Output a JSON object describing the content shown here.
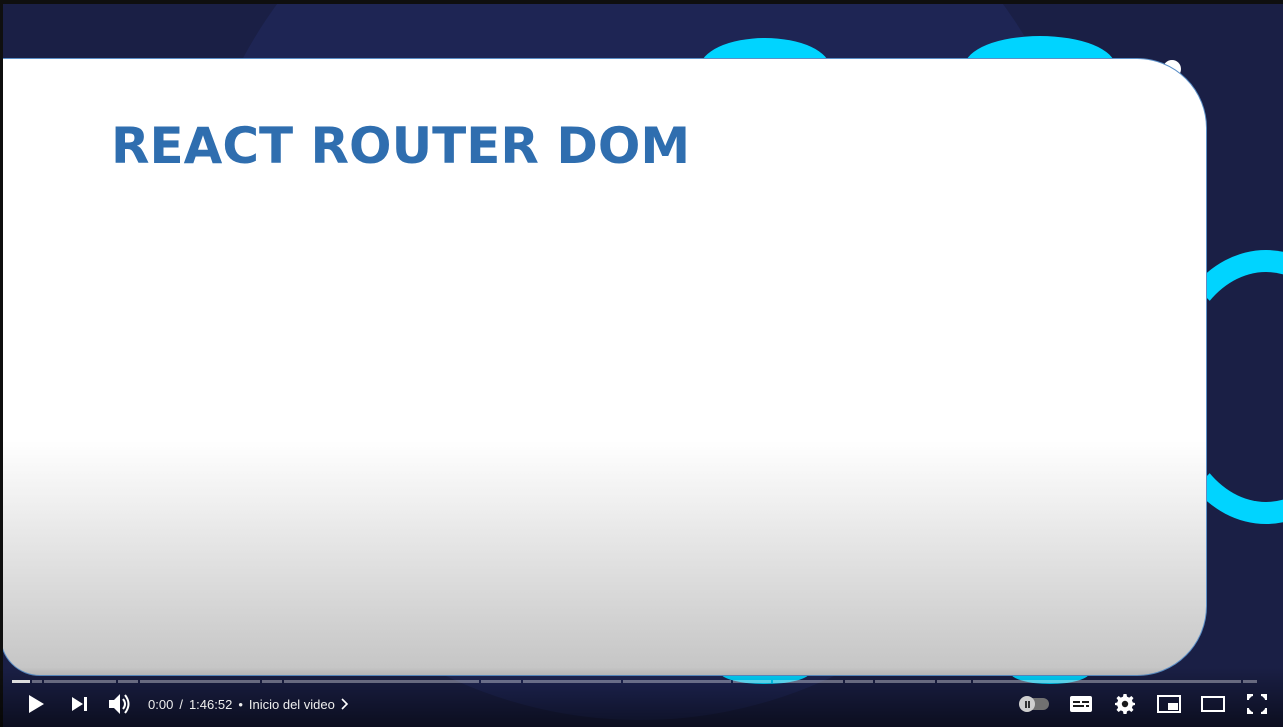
{
  "slide": {
    "title": "REACT ROUTER DOM"
  },
  "player": {
    "current_time": "0:00",
    "duration": "1:46:52",
    "separator": "/",
    "bullet": "•",
    "chapter_label": "Inicio del video",
    "progress_played_fraction": 0.0
  },
  "icons": {
    "play": "play-icon",
    "next": "next-icon",
    "volume": "volume-icon",
    "chapter_chevron": "chevron-right-icon",
    "autoplay": "autoplay-toggle-icon",
    "subtitles": "subtitles-icon",
    "settings": "gear-icon",
    "miniplayer": "miniplayer-icon",
    "theater": "theater-mode-icon",
    "fullscreen": "fullscreen-icon"
  },
  "colors": {
    "title": "#2f6eaf",
    "accent_blob": "#00d4ff",
    "background": "#1a1f45"
  }
}
